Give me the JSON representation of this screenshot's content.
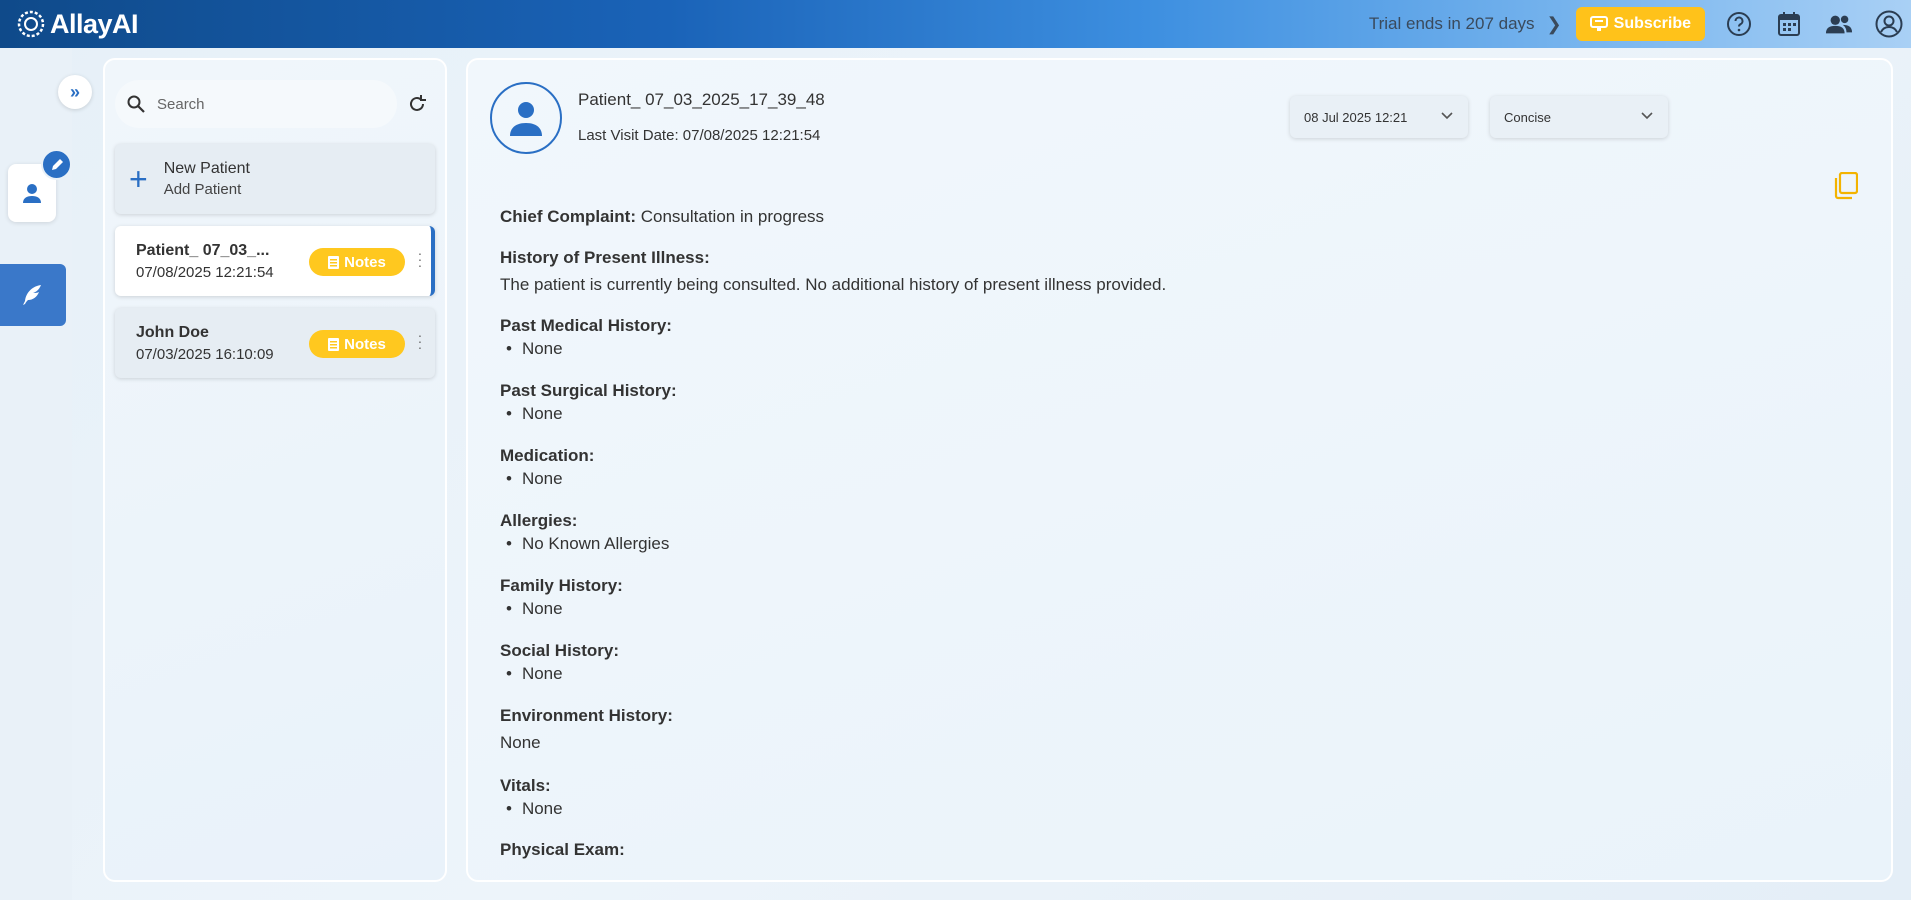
{
  "header": {
    "logo_text": "AllayAI",
    "trial_text": "Trial ends in 207 days",
    "subscribe_label": "Subscribe"
  },
  "patient_list": {
    "search_placeholder": "Search",
    "new_patient": {
      "title": "New Patient",
      "subtitle": "Add Patient"
    },
    "patients": [
      {
        "name": "Patient_ 07_03_...",
        "date": "07/08/2025 12:21:54",
        "notes_label": "Notes",
        "active": true
      },
      {
        "name": "John Doe",
        "date": "07/03/2025 16:10:09",
        "notes_label": "Notes",
        "active": false
      }
    ]
  },
  "main": {
    "patient_name": "Patient_ 07_03_2025_17_39_48",
    "last_visit": "Last Visit Date: 07/08/2025 12:21:54",
    "visit_select": "08 Jul 2025 12:21",
    "style_select": "Concise",
    "note": {
      "chief_complaint_label": "Chief Complaint:",
      "chief_complaint_value": "Consultation in progress",
      "hpi_label": "History of Present Illness:",
      "hpi_text": "The patient is currently being consulted. No additional history of present illness provided.",
      "pmh_label": "Past Medical History:",
      "pmh_item": "None",
      "psh_label": "Past Surgical History:",
      "psh_item": "None",
      "med_label": "Medication:",
      "med_item": "None",
      "allergies_label": "Allergies:",
      "allergies_item": "No Known Allergies",
      "family_label": "Family History:",
      "family_item": "None",
      "social_label": "Social History:",
      "social_item": "None",
      "env_label": "Environment History:",
      "env_text": "None",
      "vitals_label": "Vitals:",
      "vitals_item": "None",
      "exam_label": "Physical Exam:"
    }
  },
  "colors": {
    "primary": "#2a6fc4",
    "accent": "#ffc21a",
    "topbar_start": "#0f4a8a",
    "topbar_end": "#a9d0f5"
  },
  "icons": [
    "allay-logo-icon",
    "chevron-right-icon",
    "subscribe-icon",
    "help-icon",
    "calendar-icon",
    "users-icon",
    "account-icon",
    "double-chevron-right-icon",
    "patient-icon",
    "edit-icon",
    "feather-icon",
    "search-icon",
    "refresh-icon",
    "plus-icon",
    "notes-icon",
    "kebab-icon",
    "avatar-icon",
    "chevron-down-icon",
    "copy-icon"
  ]
}
